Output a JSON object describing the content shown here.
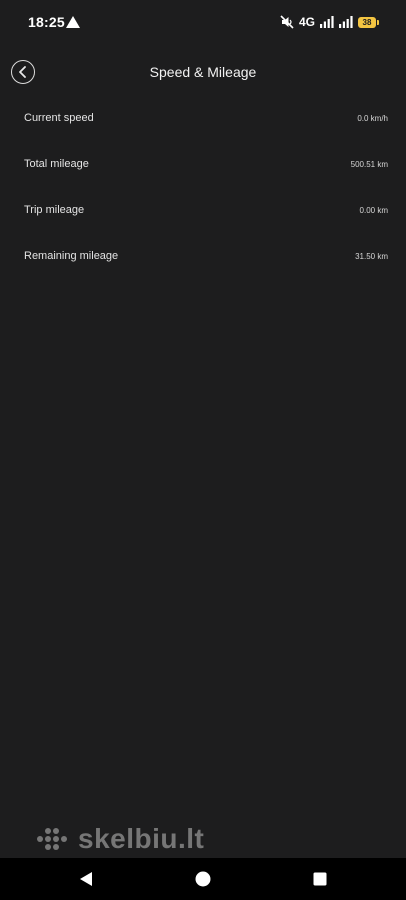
{
  "status_bar": {
    "time": "18:25",
    "network": "4G",
    "battery": "38",
    "icons": [
      "navigation-arrow-icon",
      "mute-icon",
      "signal-icon",
      "signal-icon",
      "battery-icon"
    ]
  },
  "header": {
    "title": "Speed & Mileage",
    "back_icon": "chevron-left-icon"
  },
  "rows": [
    {
      "label": "Current speed",
      "value": "0.0 km/h"
    },
    {
      "label": "Total mileage",
      "value": "500.51 km"
    },
    {
      "label": "Trip mileage",
      "value": "0.00 km"
    },
    {
      "label": "Remaining mileage",
      "value": "31.50 km"
    }
  ],
  "watermark": {
    "text": "skelbiu.lt"
  },
  "nav_bar": {
    "icons": [
      "back-triangle-icon",
      "home-circle-icon",
      "recents-square-icon"
    ]
  }
}
